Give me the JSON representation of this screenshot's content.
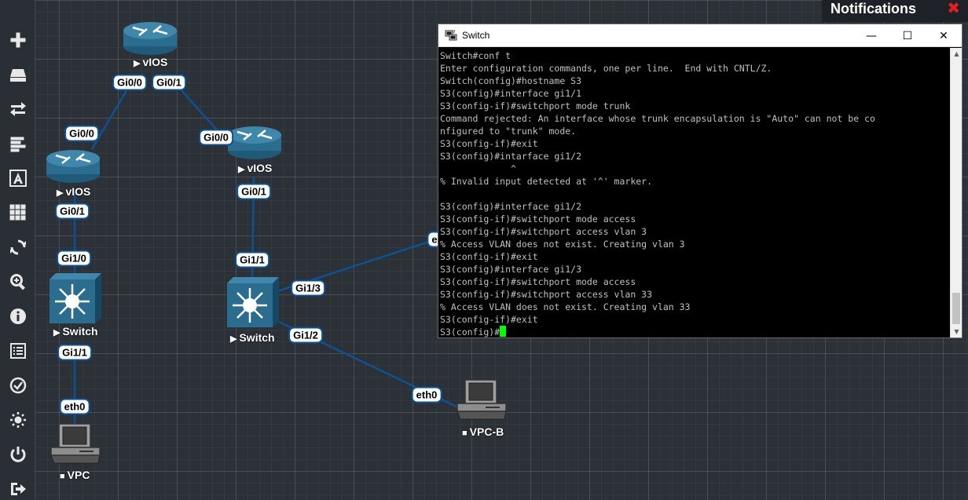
{
  "sidebar": {
    "items": [
      {
        "icon": "plus-icon"
      },
      {
        "icon": "drive-icon"
      },
      {
        "icon": "arrows-exchange-icon"
      },
      {
        "icon": "align-left-icon"
      },
      {
        "icon": "text-a-icon"
      },
      {
        "icon": "grid-icon"
      },
      {
        "icon": "refresh-icon"
      },
      {
        "icon": "zoom-in-icon"
      },
      {
        "icon": "info-icon"
      },
      {
        "icon": "list-icon"
      },
      {
        "icon": "check-circle-icon"
      },
      {
        "icon": "sun-icon"
      },
      {
        "icon": "power-icon"
      },
      {
        "icon": "sign-out-icon"
      }
    ]
  },
  "notifications": {
    "title": "Notifications",
    "close": "✖"
  },
  "topology": {
    "nodes": {
      "vios_top": "vIOS",
      "vios_left": "vIOS",
      "vios_mid": "vIOS",
      "switch_left": "Switch",
      "switch_mid": "Switch",
      "vpc": "VPC",
      "vpc_b": "VPC-B"
    },
    "ports": {
      "p1": "Gi0/0",
      "p2": "Gi0/1",
      "p3": "Gi0/0",
      "p4": "Gi0/0",
      "p5": "Gi0/1",
      "p6": "Gi0/1",
      "p7": "Gi1/0",
      "p8": "Gi1/1",
      "p9": "Gi1/1",
      "p10": "Gi1/3",
      "p11": "Gi1/2",
      "p12": "eth0",
      "p13": "eth0",
      "p14": "e"
    }
  },
  "terminal": {
    "title": "Switch",
    "minimize": "—",
    "maximize": "☐",
    "close": "✕",
    "lines": [
      "Switch#conf t",
      "Enter configuration commands, one per line.  End with CNTL/Z.",
      "Switch(config)#hostname S3",
      "S3(config)#interface gi1/1",
      "S3(config-if)#switchport mode trunk",
      "Command rejected: An interface whose trunk encapsulation is \"Auto\" can not be co",
      "nfigured to \"trunk\" mode.",
      "S3(config-if)#exit",
      "S3(config)#intarface gi1/2",
      "             ^",
      "% Invalid input detected at '^' marker.",
      "",
      "S3(config)#interface gi1/2",
      "S3(config-if)#switchport mode access",
      "S3(config-if)#switchport access vlan 3",
      "% Access VLAN does not exist. Creating vlan 3",
      "S3(config-if)#exit",
      "S3(config)#interface gi1/3",
      "S3(config-if)#switchport mode access",
      "S3(config-if)#switchport access vlan 33",
      "% Access VLAN does not exist. Creating vlan 33",
      "S3(config-if)#exit"
    ],
    "prompt": "S3(config)#"
  },
  "colors": {
    "link": "#0b5394",
    "cursor": "#00ff00",
    "canvas": "#2b3137",
    "device": "#2b6d8f"
  }
}
